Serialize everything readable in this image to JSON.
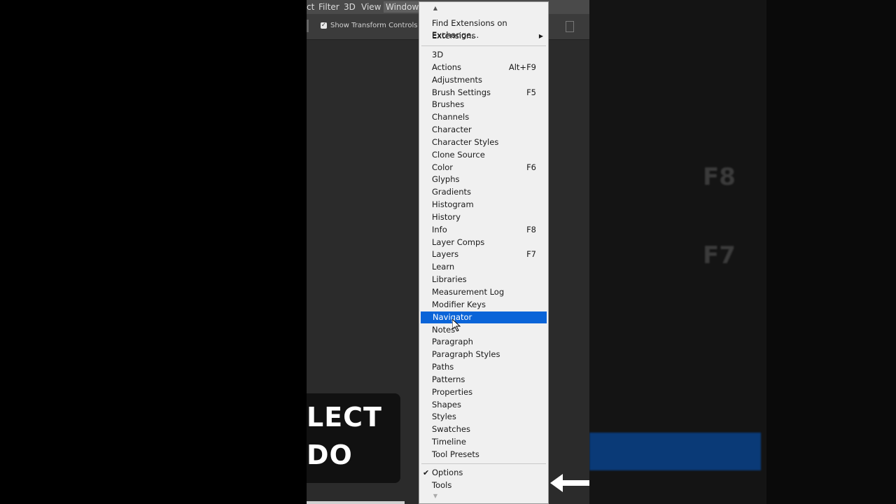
{
  "menubar": {
    "items": [
      "ct",
      "Filter",
      "3D",
      "View",
      "Window"
    ],
    "active_index": 4
  },
  "options_bar": {
    "show_transform_label": "Show Transform Controls",
    "show_transform_checked": true
  },
  "overlay": {
    "line1": "LECT",
    "line2": "DO"
  },
  "background_right": {
    "shortcut_a": "F8",
    "shortcut_b": "F7"
  },
  "window_menu": {
    "top_items": [
      {
        "label": "Find Extensions on Exchange...",
        "shortcut": ""
      },
      {
        "label": "Extensions",
        "shortcut": "",
        "submenu": true
      }
    ],
    "panel_items": [
      {
        "label": "3D",
        "shortcut": ""
      },
      {
        "label": "Actions",
        "shortcut": "Alt+F9"
      },
      {
        "label": "Adjustments",
        "shortcut": ""
      },
      {
        "label": "Brush Settings",
        "shortcut": "F5"
      },
      {
        "label": "Brushes",
        "shortcut": ""
      },
      {
        "label": "Channels",
        "shortcut": ""
      },
      {
        "label": "Character",
        "shortcut": ""
      },
      {
        "label": "Character Styles",
        "shortcut": ""
      },
      {
        "label": "Clone Source",
        "shortcut": ""
      },
      {
        "label": "Color",
        "shortcut": "F6"
      },
      {
        "label": "Glyphs",
        "shortcut": ""
      },
      {
        "label": "Gradients",
        "shortcut": ""
      },
      {
        "label": "Histogram",
        "shortcut": ""
      },
      {
        "label": "History",
        "shortcut": ""
      },
      {
        "label": "Info",
        "shortcut": "F8"
      },
      {
        "label": "Layer Comps",
        "shortcut": ""
      },
      {
        "label": "Layers",
        "shortcut": "F7"
      },
      {
        "label": "Learn",
        "shortcut": ""
      },
      {
        "label": "Libraries",
        "shortcut": ""
      },
      {
        "label": "Measurement Log",
        "shortcut": ""
      },
      {
        "label": "Modifier Keys",
        "shortcut": ""
      },
      {
        "label": "Navigator",
        "shortcut": "",
        "highlighted": true
      },
      {
        "label": "Notes",
        "shortcut": ""
      },
      {
        "label": "Paragraph",
        "shortcut": ""
      },
      {
        "label": "Paragraph Styles",
        "shortcut": ""
      },
      {
        "label": "Paths",
        "shortcut": ""
      },
      {
        "label": "Patterns",
        "shortcut": ""
      },
      {
        "label": "Properties",
        "shortcut": ""
      },
      {
        "label": "Shapes",
        "shortcut": ""
      },
      {
        "label": "Styles",
        "shortcut": ""
      },
      {
        "label": "Swatches",
        "shortcut": ""
      },
      {
        "label": "Timeline",
        "shortcut": ""
      },
      {
        "label": "Tool Presets",
        "shortcut": ""
      }
    ],
    "bottom_items": [
      {
        "label": "Options",
        "shortcut": "",
        "checked": true
      },
      {
        "label": "Tools",
        "shortcut": ""
      }
    ],
    "highlight_color": "#0a64d8"
  }
}
